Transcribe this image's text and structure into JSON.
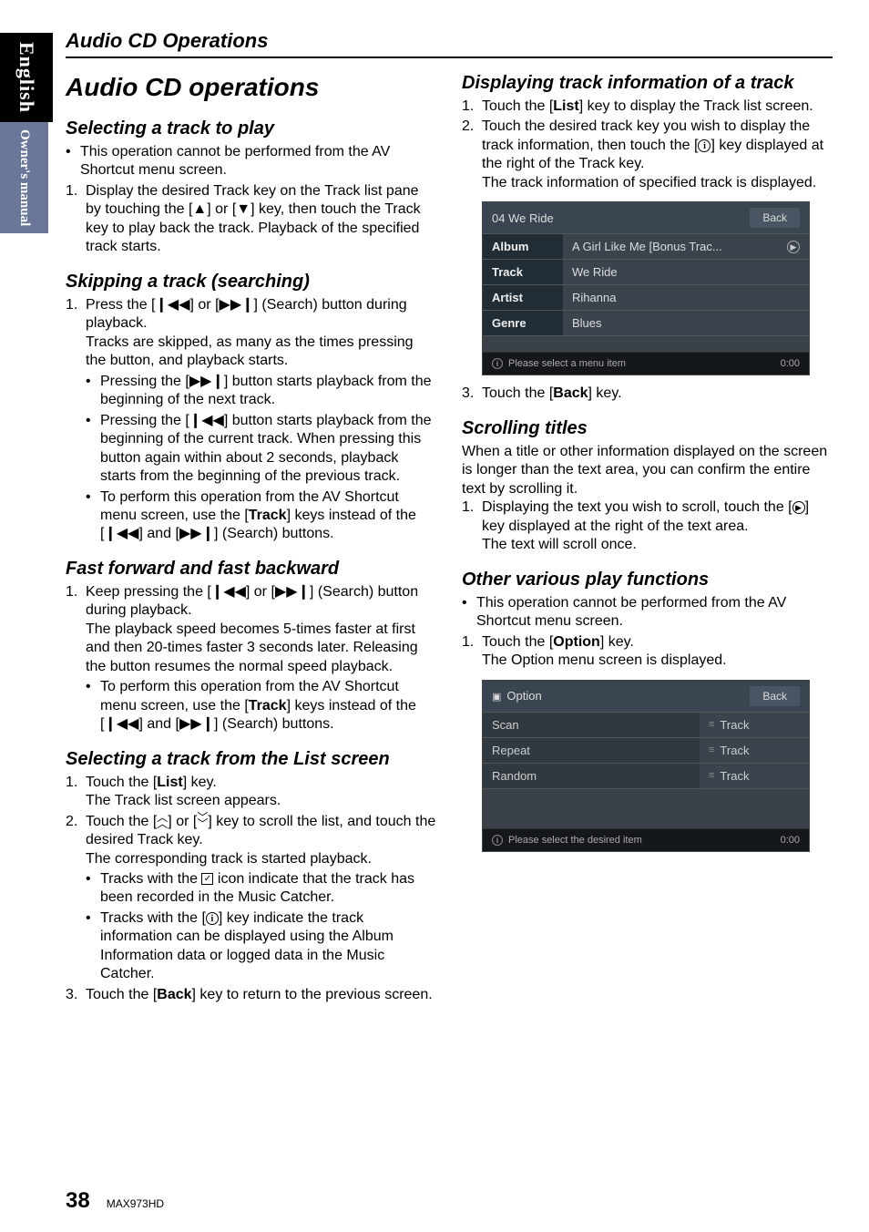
{
  "side": {
    "lang": "English",
    "manual": "Owner's manual"
  },
  "topHeading": "Audio CD Operations",
  "pageTitle": "Audio CD operations",
  "left": {
    "selectTrack": {
      "h": "Selecting a track to play",
      "b1": "This operation cannot be performed from the AV Shortcut menu screen.",
      "n1a": "Display the desired Track key on the Track list pane by touching the [",
      "n1b": "] or [",
      "n1c": "] key, then touch the Track key to play back the track. Playback of the specified track starts."
    },
    "skip": {
      "h": "Skipping a track (searching)",
      "n1a": "Press the [",
      "n1b": "] or [",
      "n1c": "] (Search) button during playback.",
      "n1d": "Tracks are skipped, as many as the times pressing the button, and playback starts.",
      "s1a": "Pressing the [",
      "s1b": "] button starts playback from the beginning of the next track.",
      "s2a": "Pressing the [",
      "s2b": "] button starts playback from the beginning of the current track. When pressing this button again within about 2 seconds, playback starts from the beginning of the previous track.",
      "s3a": "To perform this operation from the AV Shortcut menu screen, use the [",
      "track": "Track",
      "s3b": "] keys instead of the [",
      "s3c": "] and [",
      "s3d": "] (Search) buttons."
    },
    "fast": {
      "h": "Fast forward and fast backward",
      "n1a": "Keep pressing the [",
      "n1b": "] or [",
      "n1c": "] (Search) button during playback.",
      "n1d": "The playback speed becomes 5-times faster at first and then 20-times faster 3 seconds later. Releasing the button resumes the normal speed playback.",
      "s1a": "To perform this operation from the AV Shortcut menu screen, use the [",
      "track": "Track",
      "s1b": "] keys instead of the [",
      "s1c": "] and [",
      "s1d": "] (Search) buttons."
    },
    "list": {
      "h": "Selecting a track from the List screen",
      "n1a": "Touch the [",
      "listKey": "List",
      "n1b": "] key.",
      "n1c": "The Track list screen appears.",
      "n2a": "Touch the [",
      "n2b": "] or [",
      "n2c": "] key to scroll the list, and touch the desired Track key.",
      "n2d": "The corresponding track is started playback.",
      "s1a": "Tracks with the ",
      "s1b": " icon indicate that the track has been recorded in the Music Catcher.",
      "s2a": "Tracks with the [",
      "s2b": "] key indicate the track information can be displayed using the Album Information data or logged data in the Music Catcher.",
      "n3a": "Touch the [",
      "back": "Back",
      "n3b": "] key to return to the previous screen."
    }
  },
  "right": {
    "dispInfo": {
      "h": "Displaying track information of a track",
      "n1a": "Touch the [",
      "list": "List",
      "n1b": "] key to display the Track list screen.",
      "n2a": "Touch the desired track key you wish to display the track information, then touch the [",
      "n2b": "] key displayed at the right of the Track key.",
      "n2c": "The track information of specified track is displayed.",
      "n3a": "Touch the [",
      "back": "Back",
      "n3b": "] key."
    },
    "img1": {
      "title": "04 We Ride",
      "back": "Back",
      "albumL": "Album",
      "albumV": "A Girl Like Me [Bonus Trac...",
      "trackL": "Track",
      "trackV": "We Ride",
      "artistL": "Artist",
      "artistV": "Rihanna",
      "genreL": "Genre",
      "genreV": "Blues",
      "footer": "Please select a menu item",
      "time": "0:00"
    },
    "scroll": {
      "h": "Scrolling titles",
      "p": "When a title or other information displayed on the screen is longer than the text area, you can confirm the entire text by scrolling it.",
      "n1a": "Displaying the text you wish to scroll, touch the [",
      "n1b": "] key displayed at the right of the text area.",
      "n1c": "The text will scroll once."
    },
    "other": {
      "h": "Other various play functions",
      "b1": "This operation cannot be performed from the AV Shortcut menu screen.",
      "n1a": "Touch the [",
      "option": "Option",
      "n1b": "] key.",
      "n1c": "The Option menu screen is displayed."
    },
    "img2": {
      "title": "Option",
      "back": "Back",
      "r1l": "Scan",
      "r1r": "Track",
      "r2l": "Repeat",
      "r2r": "Track",
      "r3l": "Random",
      "r3r": "Track",
      "footer": "Please select the desired item",
      "time": "0:00"
    }
  },
  "footer": {
    "page": "38",
    "model": "MAX973HD"
  },
  "glyphs": {
    "up": "▲",
    "down": "▼",
    "prev": "❙◀◀",
    "next": "▶▶❙",
    "chevUp": "︿",
    "chevDown": "﹀",
    "check": "✓",
    "info": "i",
    "tri": "▶"
  }
}
